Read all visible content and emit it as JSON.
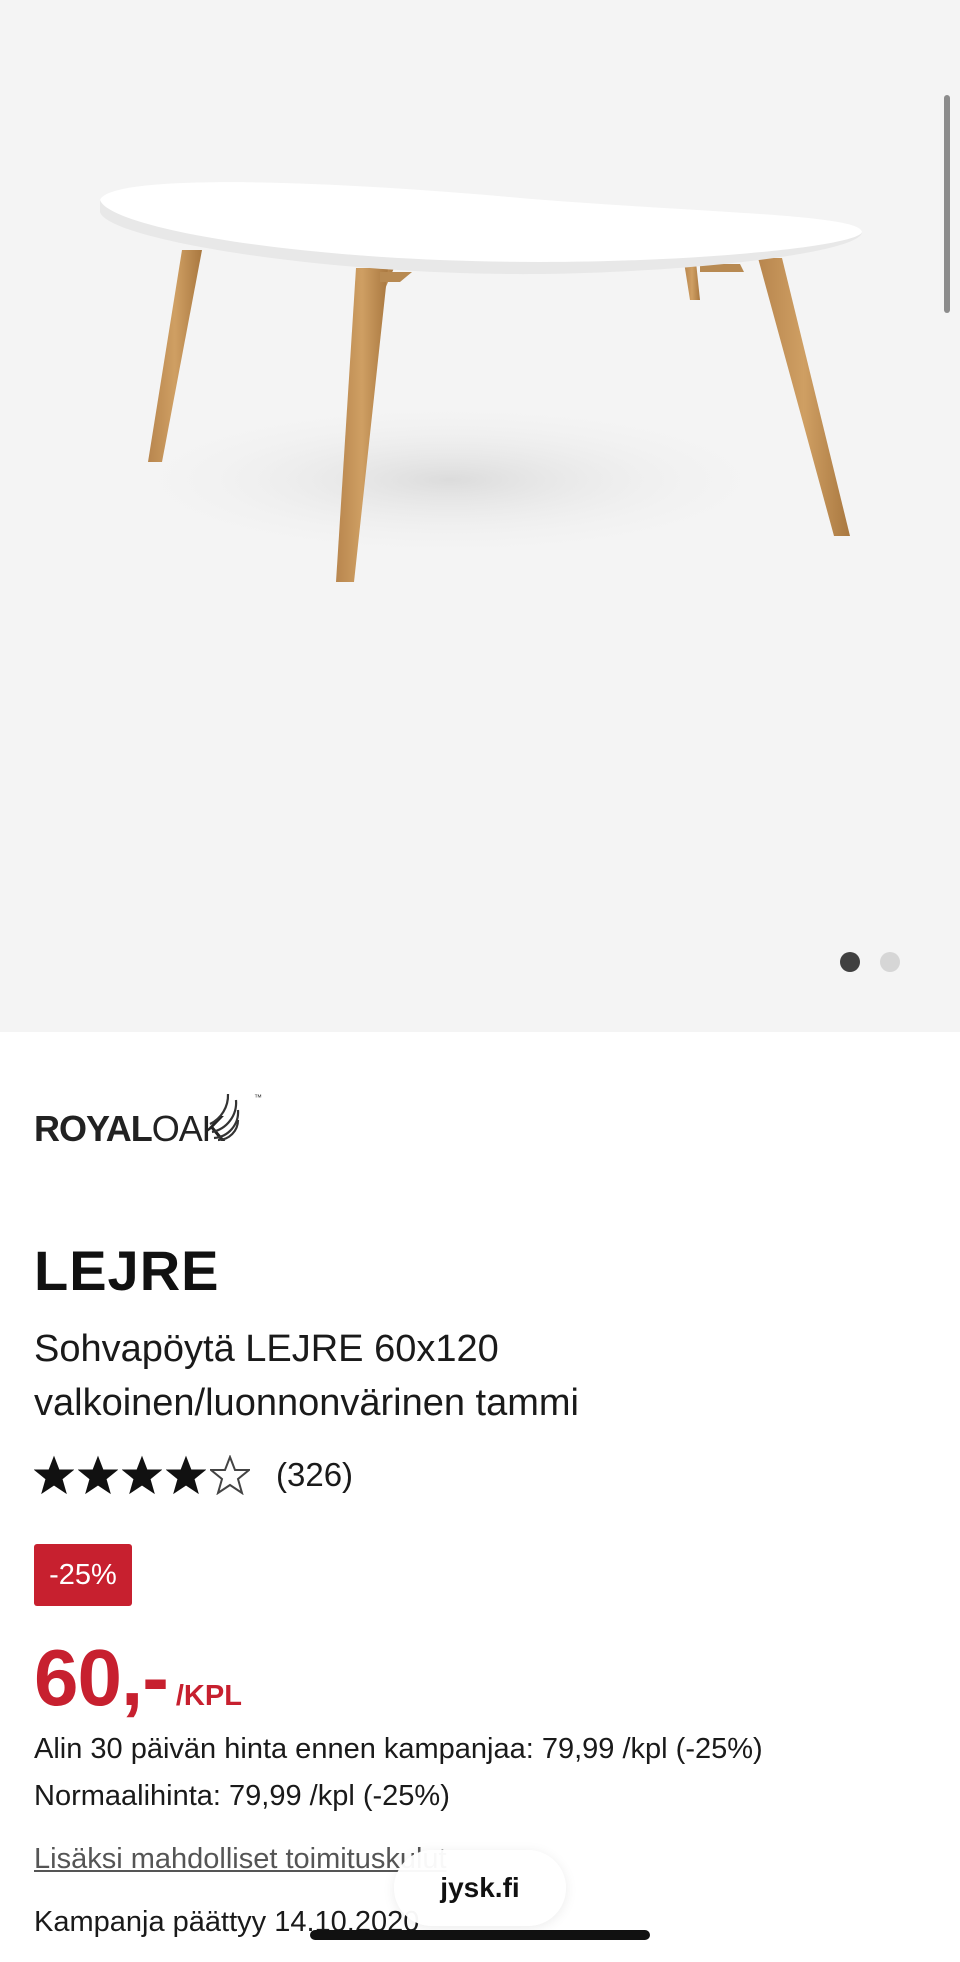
{
  "gallery": {
    "image_alt": "LEJRE coffee table, white top with oak legs",
    "slide_count": 2,
    "active_slide": 1
  },
  "brand": {
    "logo_bold": "ROYAL",
    "logo_light": "OAK",
    "logo_tm": "™"
  },
  "product": {
    "name": "LEJRE",
    "description": "Sohvapöytä LEJRE 60x120 valkoinen/luonnonvärinen tammi",
    "rating_value": 4,
    "rating_max": 5,
    "review_count": "(326)"
  },
  "pricing": {
    "discount_badge": "-25%",
    "price": "60,-",
    "unit": "/KPL",
    "lowest_30_days": "Alin 30 päivän hinta ennen kampanjaa: 79,99 /kpl (-25%)",
    "normal_price": "Normaalihinta: 79,99 /kpl (-25%)"
  },
  "links": {
    "delivery_costs": "Lisäksi mahdolliset toimituskulut"
  },
  "campaign": {
    "ends": "Kampanja päättyy 14.10.2020"
  },
  "browser": {
    "url": "jysk.fi"
  },
  "colors": {
    "accent_red": "#c7202f",
    "gallery_bg": "#f4f4f4"
  }
}
